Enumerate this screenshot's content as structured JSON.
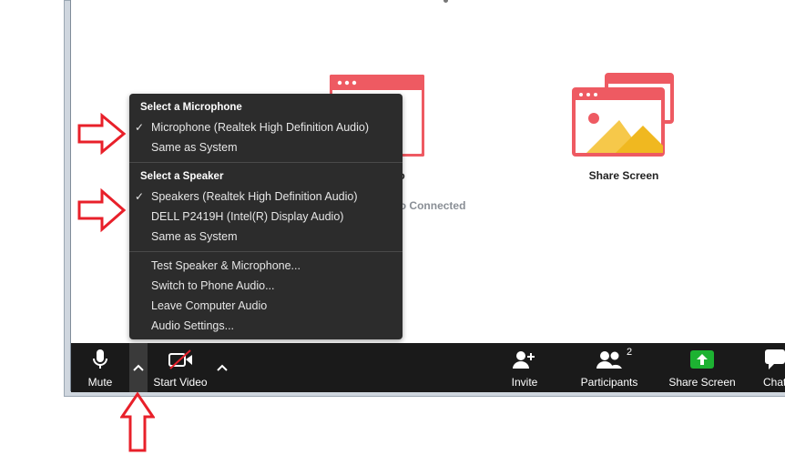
{
  "tiles": {
    "join_audio": {
      "label": "Join Audio",
      "sub": "Computer Audio Connected"
    },
    "share_screen": {
      "label": "Share Screen"
    }
  },
  "menu": {
    "mic_header": "Select a Microphone",
    "mic_items": [
      {
        "label": "Microphone (Realtek High Definition Audio)",
        "checked": true
      },
      {
        "label": "Same as System",
        "checked": false
      }
    ],
    "speaker_header": "Select a Speaker",
    "speaker_items": [
      {
        "label": "Speakers (Realtek High Definition Audio)",
        "checked": true
      },
      {
        "label": "DELL P2419H (Intel(R) Display Audio)",
        "checked": false
      },
      {
        "label": "Same as System",
        "checked": false
      }
    ],
    "actions": [
      "Test Speaker & Microphone...",
      "Switch to Phone Audio...",
      "Leave Computer Audio",
      "Audio Settings..."
    ]
  },
  "toolbar": {
    "mute": "Mute",
    "start_video": "Start Video",
    "invite": "Invite",
    "participants": "Participants",
    "participants_count": "2",
    "share_screen": "Share Screen",
    "chat": "Chat"
  },
  "colors": {
    "tile_accent": "#ee5a62",
    "share_green": "#1db232",
    "annotation_arrow": "#e8202a",
    "menu_bg": "#2c2c2c",
    "toolbar_bg": "#1a1a1a"
  },
  "icons": [
    "microphone-icon",
    "caret-up-icon",
    "video-camera-off-icon",
    "add-user-icon",
    "participants-icon",
    "share-screen-icon",
    "chat-icon",
    "checkmark-icon"
  ]
}
